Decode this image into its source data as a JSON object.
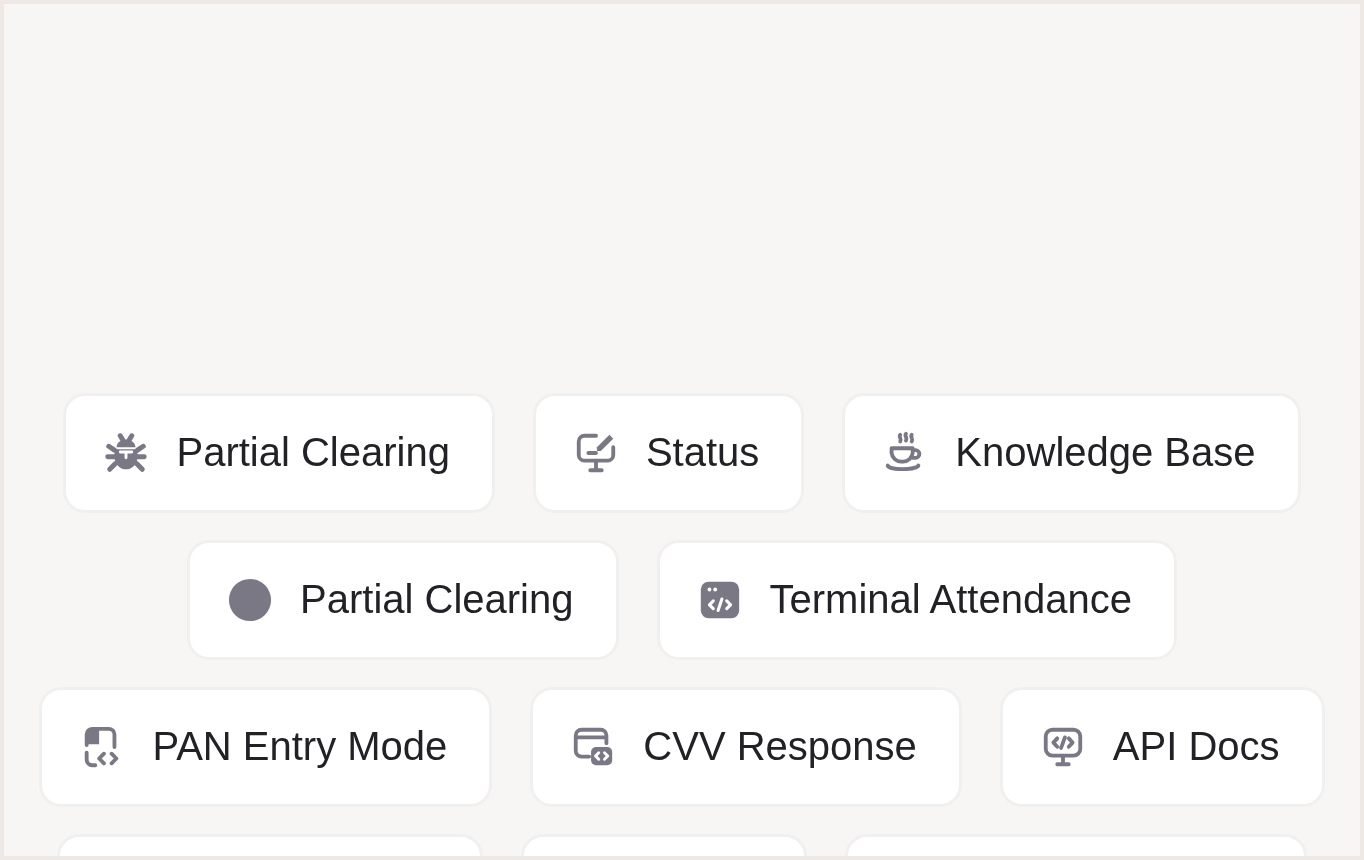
{
  "rows": [
    [
      {
        "kind": "chip",
        "label": "Partial Clearing"
      },
      {
        "kind": "chip",
        "label": "Status"
      },
      {
        "kind": "chip",
        "label": "Knowledge Base"
      }
    ],
    [
      {
        "kind": "chip",
        "label": "Partial Clearing"
      },
      {
        "kind": "chip",
        "label": "Terminal Attendance"
      }
    ],
    [
      {
        "kind": "chip",
        "label": "PAN Entry Mode"
      },
      {
        "kind": "chip",
        "label": "CVV Response"
      },
      {
        "kind": "chip",
        "label": "API Docs"
      }
    ],
    [
      {
        "kind": "blank"
      },
      {
        "kind": "blank"
      },
      {
        "kind": "blank"
      }
    ]
  ]
}
